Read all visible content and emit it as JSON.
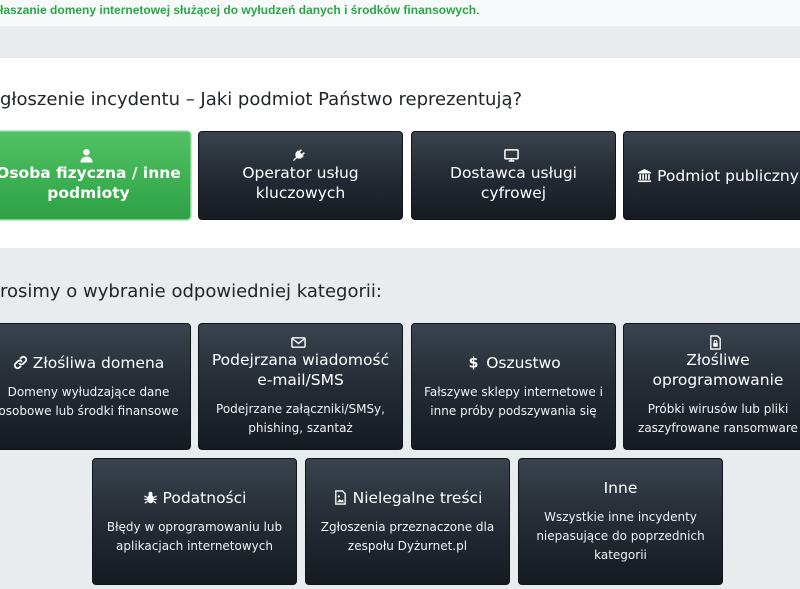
{
  "notice": {
    "text": "łaszanie domeny internetowej służącej do wyłudzeń danych i środków finansowych",
    "trailing": "."
  },
  "entity_section": {
    "title": "głoszenie incydentu – Jaki podmiot Państwo reprezentują?",
    "options": [
      {
        "label": "Osoba fizyczna / inne podmioty",
        "icon": "user-icon",
        "active": true
      },
      {
        "label": "Operator usług kluczowych",
        "icon": "plug-icon",
        "active": false
      },
      {
        "label": "Dostawca usługi cyfrowej",
        "icon": "monitor-icon",
        "active": false
      },
      {
        "label": "Podmiot publiczny",
        "icon": "institution-icon",
        "active": false
      }
    ]
  },
  "category_section": {
    "title": "rosimy o wybranie odpowiedniej kategorii:",
    "categories": [
      {
        "label": "Złośliwa domena",
        "icon": "link-icon",
        "description": "Domeny wyłudzające dane osobowe lub środki finansowe"
      },
      {
        "label": "Podejrzana wiadomość e-mail/SMS",
        "icon": "envelope-icon",
        "description": "Podejrzane załączniki/SMSy, phishing, szantaż"
      },
      {
        "label": "Oszustwo",
        "icon": "dollar-icon",
        "description": "Fałszywe sklepy internetowe i inne próby podszywania się"
      },
      {
        "label": "Złośliwe oprogramowanie",
        "icon": "file-lock-icon",
        "description": "Próbki wirusów lub pliki zaszyfrowane ransomware"
      },
      {
        "label": "Podatności",
        "icon": "bug-icon",
        "description": "Błędy w oprogramowaniu lub aplikacjach internetowych"
      },
      {
        "label": "Nielegalne treści",
        "icon": "image-icon",
        "description": "Zgłoszenia przeznaczone dla zespołu Dyżurnet.pl"
      },
      {
        "label": "Inne",
        "icon": "",
        "description": "Wszystkie inne incydenty niepasujące do poprzednich kategorii"
      }
    ]
  },
  "colors": {
    "active_tile": "#3fb254",
    "dark_tile": "#262d36",
    "notice_text": "#28a745",
    "page_background": "#e9ecef"
  }
}
